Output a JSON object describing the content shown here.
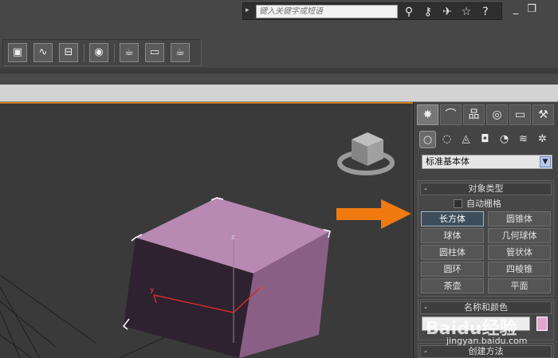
{
  "search": {
    "placeholder": "键入关键字或短语",
    "arrow": "▸",
    "icons": [
      "binoculars-icon",
      "key-icon",
      "satellite-icon",
      "star-icon",
      "help-icon"
    ]
  },
  "window_controls": [
    "_",
    "❐"
  ],
  "command_panel": {
    "tabs": [
      "create-tab",
      "modify-tab",
      "hierarchy-tab",
      "motion-tab",
      "display-tab",
      "utilities-tab"
    ],
    "subtabs": [
      "geometry",
      "shapes",
      "lights",
      "cameras",
      "helpers",
      "space-warps",
      "systems"
    ],
    "dropdown_value": "标准基本体",
    "object_type": {
      "title": "对象类型",
      "autogrid_label": "自动栅格",
      "buttons": [
        "长方体",
        "圆锥体",
        "球体",
        "几何球体",
        "圆柱体",
        "管状体",
        "圆环",
        "四棱锥",
        "茶壶",
        "平面"
      ],
      "selected": "长方体"
    },
    "name_color": {
      "title": "名称和颜色",
      "color": "#e1a5d0"
    },
    "creation_method": {
      "title": "创建方法"
    }
  },
  "viewport": {
    "axis_x": "x",
    "axis_y": "y",
    "axis_z": "z",
    "box_top_color": "#b889b3",
    "box_front_color": "#2f2230",
    "box_side_color": "#8a5f86"
  },
  "annotation": {
    "arrow_color": "#f07a10"
  },
  "watermark": {
    "text": "Baidu经验",
    "url": "jingyan.baidu.com"
  }
}
